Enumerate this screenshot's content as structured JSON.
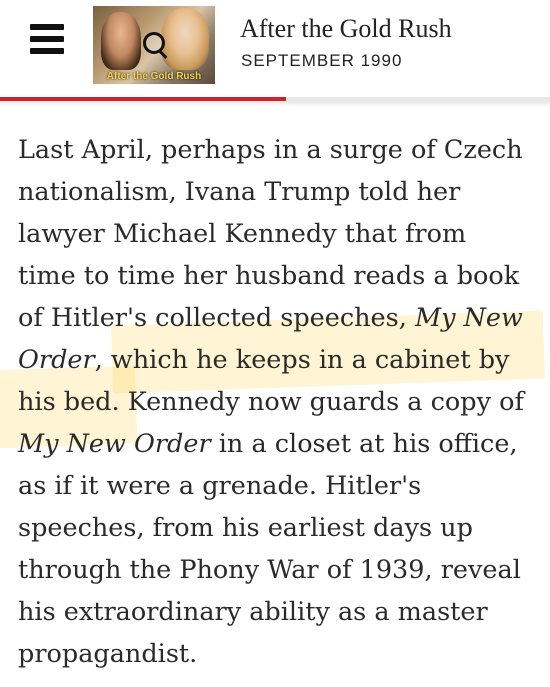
{
  "header": {
    "menu_icon": "hamburger-menu-icon",
    "thumbnail_caption": "After the Gold Rush",
    "thumbnail_icon": "magnifier-icon",
    "title": "After the Gold Rush",
    "date": "SEPTEMBER 1990",
    "reading_progress_percent": 52,
    "accent_color": "#d0202a"
  },
  "article": {
    "lines": [
      [
        {
          "text": "Last April, perhaps in a surge of Czech"
        }
      ],
      [
        {
          "text": "nationalism, Ivana Trump told her"
        }
      ],
      [
        {
          "text": "lawyer Michael Kennedy that from"
        }
      ],
      [
        {
          "text": "time to time her husband reads a book"
        }
      ],
      [
        {
          "text": "of Hitler's collected speeches, "
        },
        {
          "text": "My New",
          "italic": true
        }
      ],
      [
        {
          "text": "Order",
          "italic": true
        },
        {
          "text": ", which he keeps in a cabinet by"
        }
      ],
      [
        {
          "text": "his bed. Kennedy now guards a copy of"
        }
      ],
      [
        {
          "text": "My New Order",
          "italic": true
        },
        {
          "text": " in a closet at his office,"
        }
      ],
      [
        {
          "text": "as if it were a grenade. Hitler's"
        }
      ],
      [
        {
          "text": "speeches, from his earliest days up"
        }
      ],
      [
        {
          "text": "through the Phony War of 1939, reveal"
        }
      ],
      [
        {
          "text": "his extraordinary ability as a master"
        }
      ],
      [
        {
          "text": "propagandist."
        }
      ]
    ],
    "highlight_color": "#ffdc6e"
  }
}
